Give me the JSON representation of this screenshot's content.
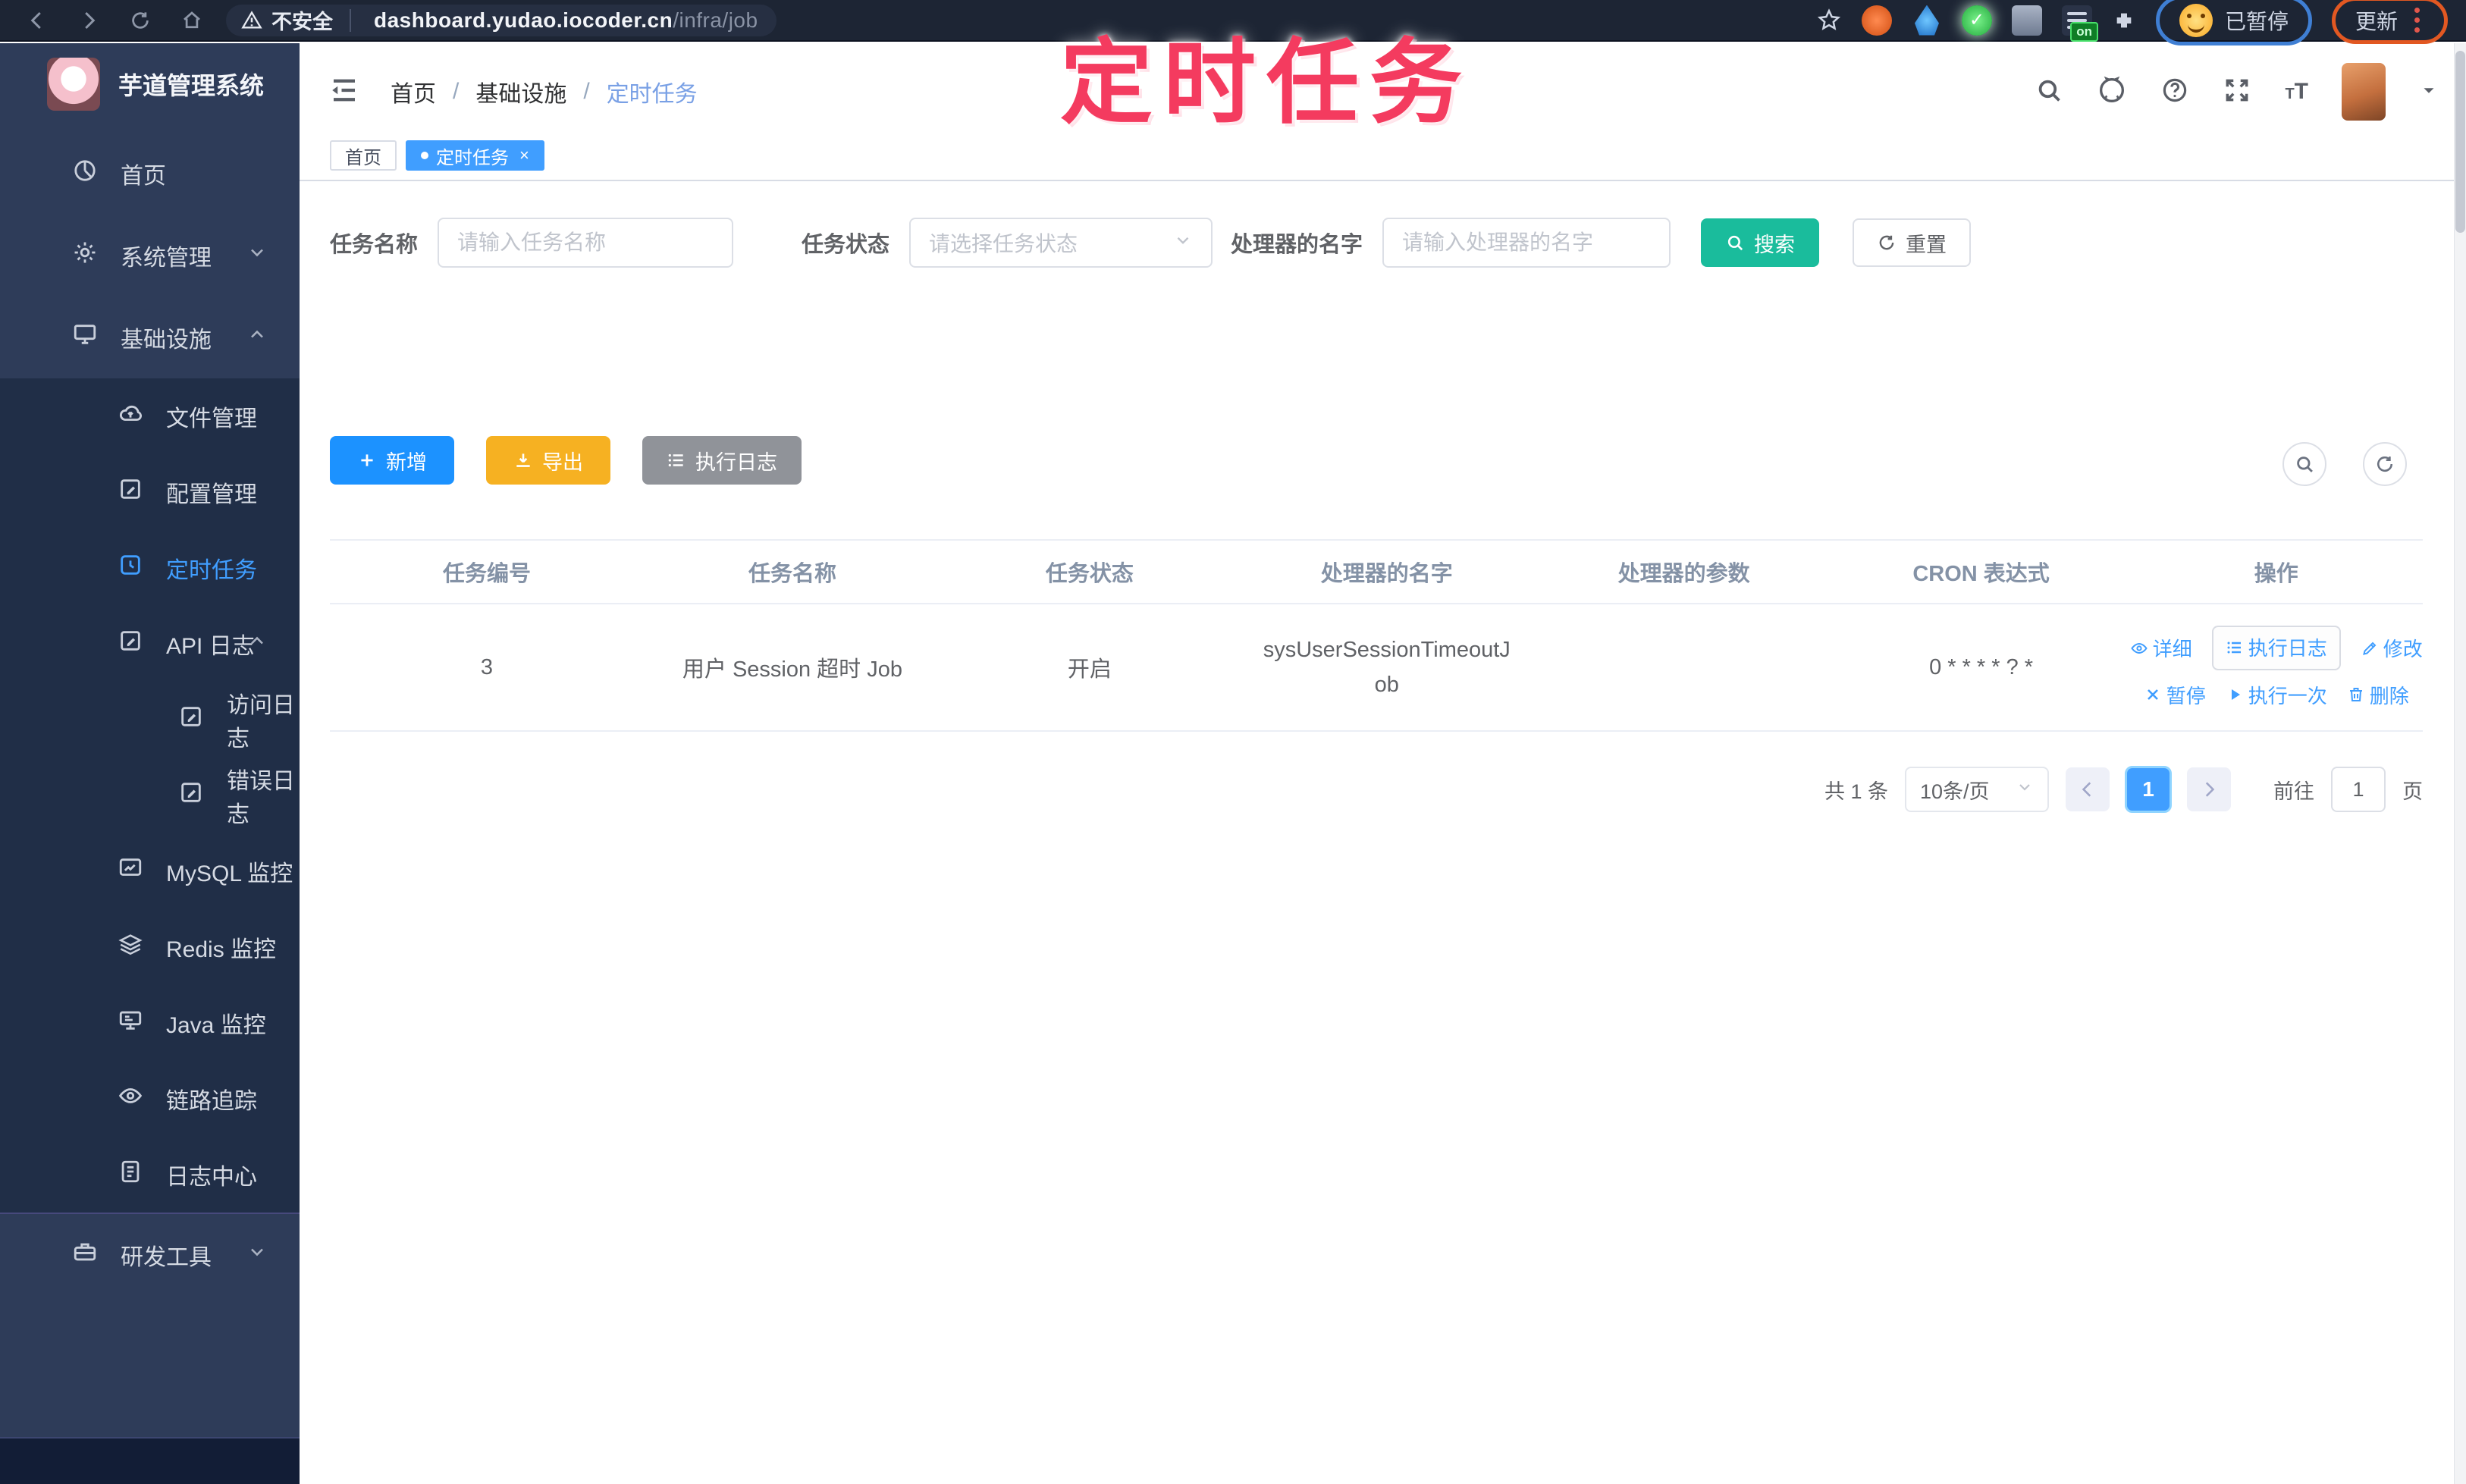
{
  "browser": {
    "security_label": "不安全",
    "url_host": "dashboard.yudao.iocoder.cn",
    "url_path": "/infra/job",
    "extension_badge": "on",
    "paused_label": "已暂停",
    "update_label": "更新"
  },
  "watermark": {
    "text": "定时任务",
    "color": "#f43b5f"
  },
  "sidebar": {
    "brand": "芋道管理系统",
    "items": [
      {
        "label": "首页",
        "icon": "dashboard-icon"
      },
      {
        "label": "系统管理",
        "icon": "gear-icon",
        "chevron": "down"
      },
      {
        "label": "基础设施",
        "icon": "monitor-icon",
        "chevron": "up",
        "expanded": true
      },
      {
        "label": "文件管理",
        "icon": "cloud-upload-icon"
      },
      {
        "label": "配置管理",
        "icon": "edit-square-icon"
      },
      {
        "label": "定时任务",
        "icon": "timer-icon",
        "active": true
      },
      {
        "label": "API 日志",
        "icon": "api-log-icon",
        "chevron": "up",
        "expanded": true
      },
      {
        "label": "访问日志",
        "icon": "access-log-icon"
      },
      {
        "label": "错误日志",
        "icon": "error-log-icon"
      },
      {
        "label": "MySQL 监控",
        "icon": "mysql-monitor-icon"
      },
      {
        "label": "Redis 监控",
        "icon": "redis-monitor-icon"
      },
      {
        "label": "Java 监控",
        "icon": "java-monitor-icon"
      },
      {
        "label": "链路追踪",
        "icon": "trace-icon"
      },
      {
        "label": "日志中心",
        "icon": "log-center-icon"
      },
      {
        "label": "研发工具",
        "icon": "toolbox-icon",
        "chevron": "down"
      }
    ]
  },
  "header": {
    "breadcrumb": [
      "首页",
      "基础设施",
      "定时任务"
    ]
  },
  "tabs": [
    {
      "label": "首页",
      "active": false
    },
    {
      "label": "定时任务",
      "active": true,
      "close": "×"
    }
  ],
  "filters": {
    "task_name_label": "任务名称",
    "task_name_placeholder": "请输入任务名称",
    "task_status_label": "任务状态",
    "task_status_placeholder": "请选择任务状态",
    "handler_label": "处理器的名字",
    "handler_placeholder": "请输入处理器的名字",
    "search_label": "搜索",
    "reset_label": "重置"
  },
  "toolbar": {
    "add_label": "新增",
    "export_label": "导出",
    "exec_log_label": "执行日志"
  },
  "table": {
    "columns": [
      "任务编号",
      "任务名称",
      "任务状态",
      "处理器的名字",
      "处理器的参数",
      "CRON 表达式",
      "操作"
    ],
    "rows": [
      {
        "id": "3",
        "name": "用户 Session 超时 Job",
        "status": "开启",
        "handler_name": "sysUserSessionTimeoutJob",
        "handler_param": "",
        "cron": "0 * * * * ? *",
        "actions": [
          "详细",
          "执行日志",
          "修改",
          "暂停",
          "执行一次",
          "删除"
        ]
      }
    ]
  },
  "pagination": {
    "total_label": "共 1 条",
    "page_size_label": "10条/页",
    "current_page": "1",
    "goto_label": "前往",
    "goto_value": "1",
    "page_unit_label": "页"
  },
  "colors": {
    "accent_blue": "#409eff",
    "search_teal": "#1abc9c",
    "export_yellow": "#f6b122",
    "info_gray": "#909399",
    "watermark_pink": "#f43b5f"
  }
}
